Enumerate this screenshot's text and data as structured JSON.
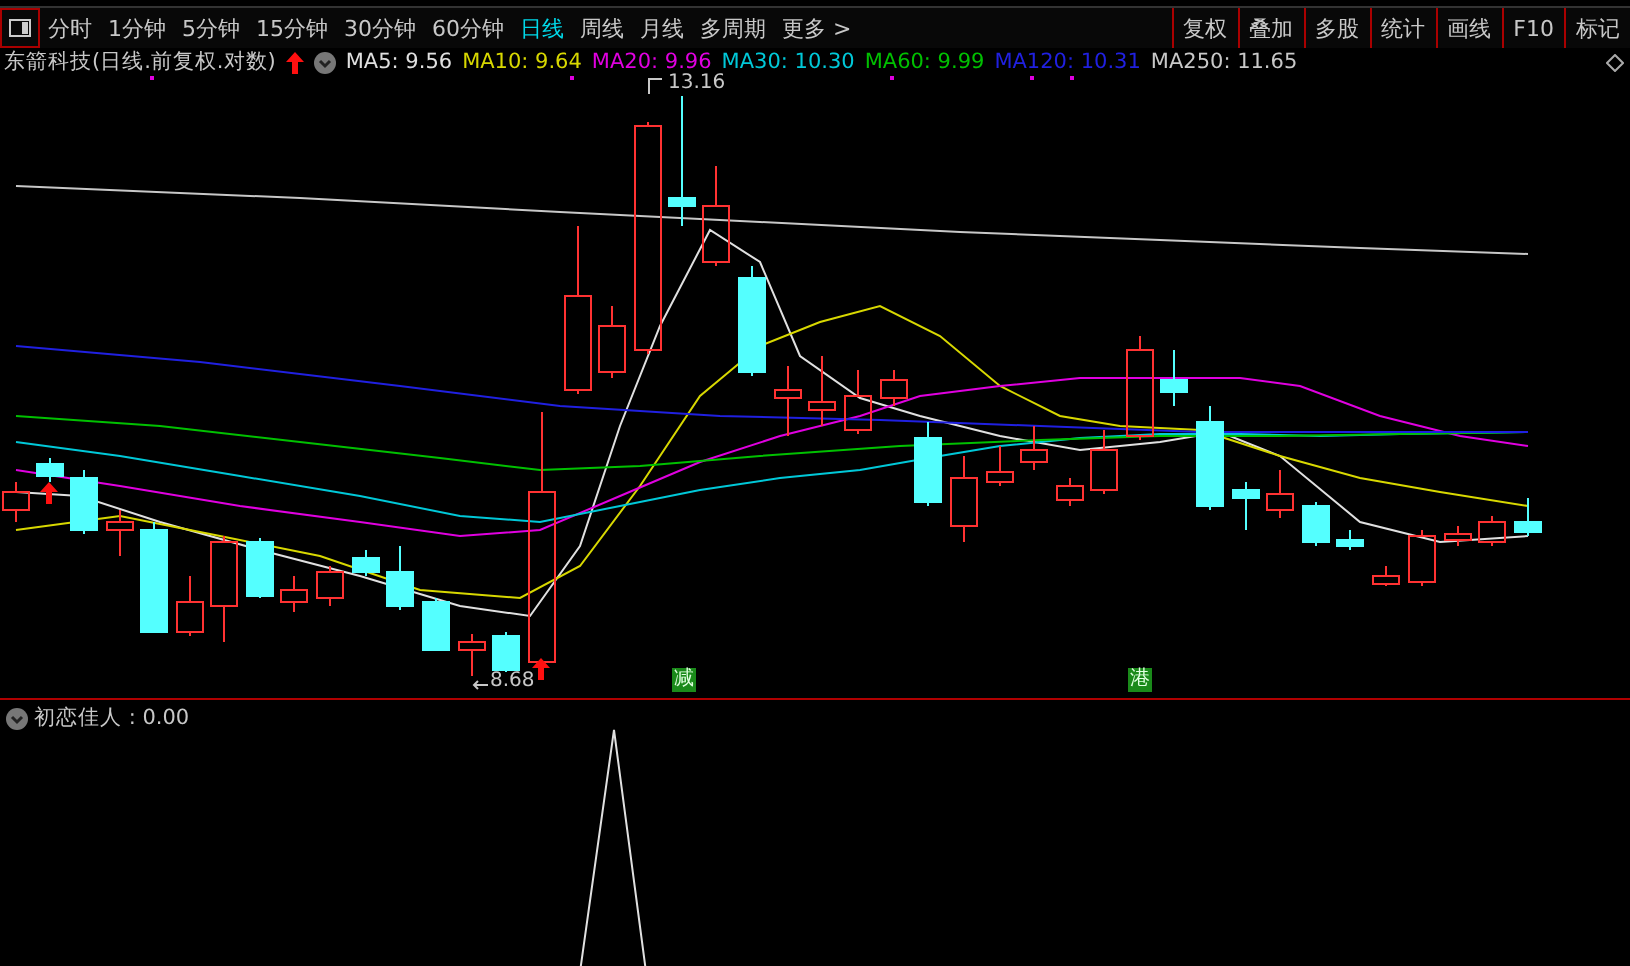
{
  "toolbar": {
    "periods": [
      {
        "label": "分时",
        "selected": false
      },
      {
        "label": "1分钟",
        "selected": false
      },
      {
        "label": "5分钟",
        "selected": false
      },
      {
        "label": "15分钟",
        "selected": false
      },
      {
        "label": "30分钟",
        "selected": false
      },
      {
        "label": "60分钟",
        "selected": false
      },
      {
        "label": "日线",
        "selected": true
      },
      {
        "label": "周线",
        "selected": false
      },
      {
        "label": "月线",
        "selected": false
      },
      {
        "label": "多周期",
        "selected": false
      },
      {
        "label": "更多 >",
        "selected": false
      }
    ],
    "buttons": [
      "复权",
      "叠加",
      "多股",
      "统计",
      "画线",
      "F10",
      "标记"
    ]
  },
  "legend": {
    "title": "东箭科技(日线.前复权.对数)",
    "averages": [
      {
        "label": "MA5: 9.56",
        "color": "#e0e0e0"
      },
      {
        "label": "MA10: 9.64",
        "color": "#d8d800"
      },
      {
        "label": "MA20: 9.96",
        "color": "#e000e0"
      },
      {
        "label": "MA30: 10.30",
        "color": "#00c8d8"
      },
      {
        "label": "MA60: 9.99",
        "color": "#00c000"
      },
      {
        "label": "MA120: 10.31",
        "color": "#2020e0"
      },
      {
        "label": "MA250: 11.65",
        "color": "#c8c8c8"
      }
    ]
  },
  "chart": {
    "high_label": "13.16",
    "low_label": "8.68",
    "signals": [
      "减",
      "港"
    ]
  },
  "indicator": {
    "label": "初恋佳人 : 0.00"
  }
}
